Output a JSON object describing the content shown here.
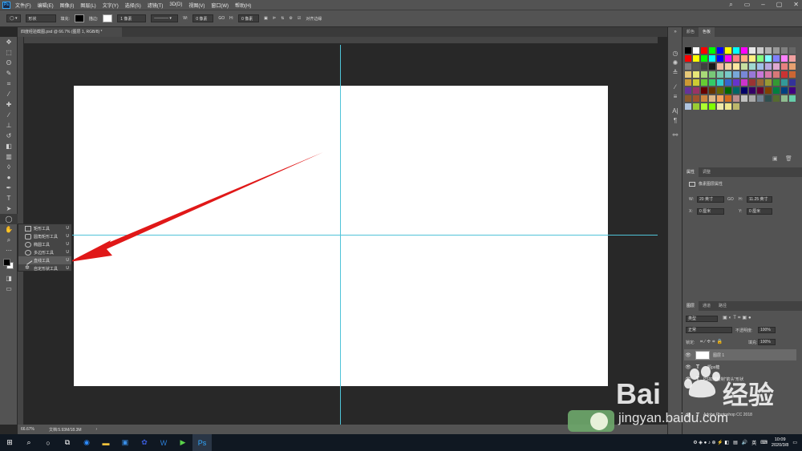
{
  "menubar": {
    "logo": "Ps",
    "items": [
      "文件(F)",
      "编辑(E)",
      "图像(I)",
      "图层(L)",
      "文字(Y)",
      "选择(S)",
      "滤镜(T)",
      "3D(D)",
      "视图(V)",
      "窗口(W)",
      "帮助(H)"
    ]
  },
  "options": {
    "mode": "形状",
    "fill_label": "填充:",
    "stroke_label": "描边:",
    "stroke_width": "1 像素",
    "w_label": "W:",
    "w_value": "0 像素",
    "link": "GO",
    "h_label": "H:",
    "h_value": "0 像素",
    "align_edges": "对齐边缘"
  },
  "document": {
    "tab_title": "四度经验截图.psd @ 66.7% (图层 1, RGB/8) *",
    "zoom": "66.67%",
    "doc_size": "文档:5.93M/18.3M"
  },
  "flyout": [
    {
      "label": "矩形工具",
      "key": "U"
    },
    {
      "label": "圆角矩形工具",
      "key": "U"
    },
    {
      "label": "椭圆工具",
      "key": "U"
    },
    {
      "label": "多边形工具",
      "key": "U"
    },
    {
      "label": "直线工具",
      "key": "U"
    },
    {
      "label": "自定形状工具",
      "key": "U"
    }
  ],
  "swatches_panel": {
    "tab1": "颜色",
    "tab2": "色板"
  },
  "properties_panel": {
    "tab1": "属性",
    "tab2": "调整",
    "subtitle": "像素图层属性",
    "w_label": "W:",
    "w_value": "20 英寸",
    "link": "GO",
    "h_label": "H:",
    "h_value": "11.25 英寸",
    "x_label": "X:",
    "x_value": "0 厘米",
    "y_label": "Y:",
    "y_value": "0 厘米"
  },
  "layers_panel": {
    "tab1": "图层",
    "tab2": "通道",
    "tab3": "路径",
    "filter": "类型",
    "blend": "正常",
    "opacity_label": "不透明度:",
    "opacity_value": "100%",
    "lock_label": "锁定:",
    "fill_label": "填充:",
    "fill_value": "100%",
    "layers": [
      {
        "name": "图层 1",
        "type": "pixel"
      },
      {
        "name": "一颗ps糖",
        "type": "text"
      },
      {
        "name": "PS如何绘制\"箭头\"形状",
        "type": "text"
      },
      {
        "name": "Adobe Photoshop CC 2018",
        "type": "text"
      }
    ]
  },
  "taskbar": {
    "lang": "英",
    "time": "10:09",
    "date": "2020/3/8"
  },
  "watermark": {
    "brand": "Bai",
    "brand2": "经验",
    "url": "jingyan.baidu.com"
  },
  "colors": {
    "guide": "#4fc3d8",
    "arrow": "#e01818",
    "ps_blue": "#31a8ff"
  }
}
